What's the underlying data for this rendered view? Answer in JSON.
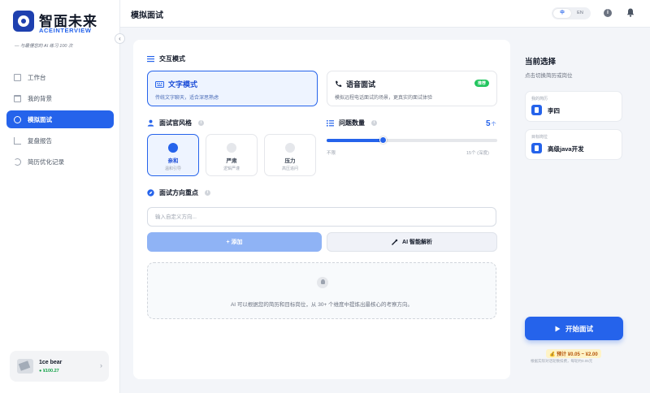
{
  "brand": {
    "name_cn": "智面未来",
    "name_en": "ACEINTERVIEW",
    "tagline": "— 与最懂您的 AI 练习 100 次",
    "accent": "#2563eb"
  },
  "sidebar": {
    "collapse_glyph": "‹",
    "items": [
      {
        "label": "工作台",
        "icon": "dashboard-icon"
      },
      {
        "label": "我的背景",
        "icon": "folder-icon"
      },
      {
        "label": "模拟面试",
        "icon": "headset-icon",
        "active": true
      },
      {
        "label": "复盘报告",
        "icon": "chart-icon"
      },
      {
        "label": "简历优化记录",
        "icon": "history-icon"
      }
    ],
    "user": {
      "name": "1ce bear",
      "balance": "¥100.27",
      "chevron": "›"
    }
  },
  "header": {
    "title": "模拟面试",
    "lang_options": [
      "中",
      "EN"
    ],
    "lang_selected": "中"
  },
  "main": {
    "interaction_mode": {
      "title": "交互模式",
      "options": [
        {
          "title": "文字模式",
          "desc": "传统文字聊天，适合深思熟虑",
          "selected": true
        },
        {
          "title": "语音面试",
          "desc": "模拟远程电话面试的场景，更真实的面试体验",
          "badge": "推荐",
          "selected": false
        }
      ]
    },
    "interviewer_style": {
      "title": "面试官风格",
      "options": [
        {
          "name": "亲和",
          "sub": "温和引导",
          "selected": true
        },
        {
          "name": "严肃",
          "sub": "逻辑严谨",
          "selected": false
        },
        {
          "name": "压力",
          "sub": "高压追问",
          "selected": false
        }
      ]
    },
    "question_count": {
      "title": "问题数量",
      "value": "5",
      "unit": "个",
      "min_label": "不限",
      "max_label": "15个 (深度)",
      "fraction": 0.33
    },
    "focus": {
      "title": "面试方向重点",
      "input_placeholder": "输入自定义方向...",
      "input_value": "",
      "add_label": "+ 添加",
      "ai_label": "AI 智能解析",
      "empty_text": "AI 可以根据您的简历和目标岗位，从 30+ 个维度中提炼出最核心的考察方向。"
    }
  },
  "right_panel": {
    "title": "当前选择",
    "subtitle": "点击切换简历或岗位",
    "resume": {
      "label": "我的简历",
      "value": "李四"
    },
    "target": {
      "label": "目标岗位",
      "value": "高级java开发"
    },
    "start_label": "开始面试",
    "estimate": "预计 ¥0.05 ~ ¥2.00",
    "estimate_note": "根据实际对话轮数扣费，每轮约0.05元"
  }
}
